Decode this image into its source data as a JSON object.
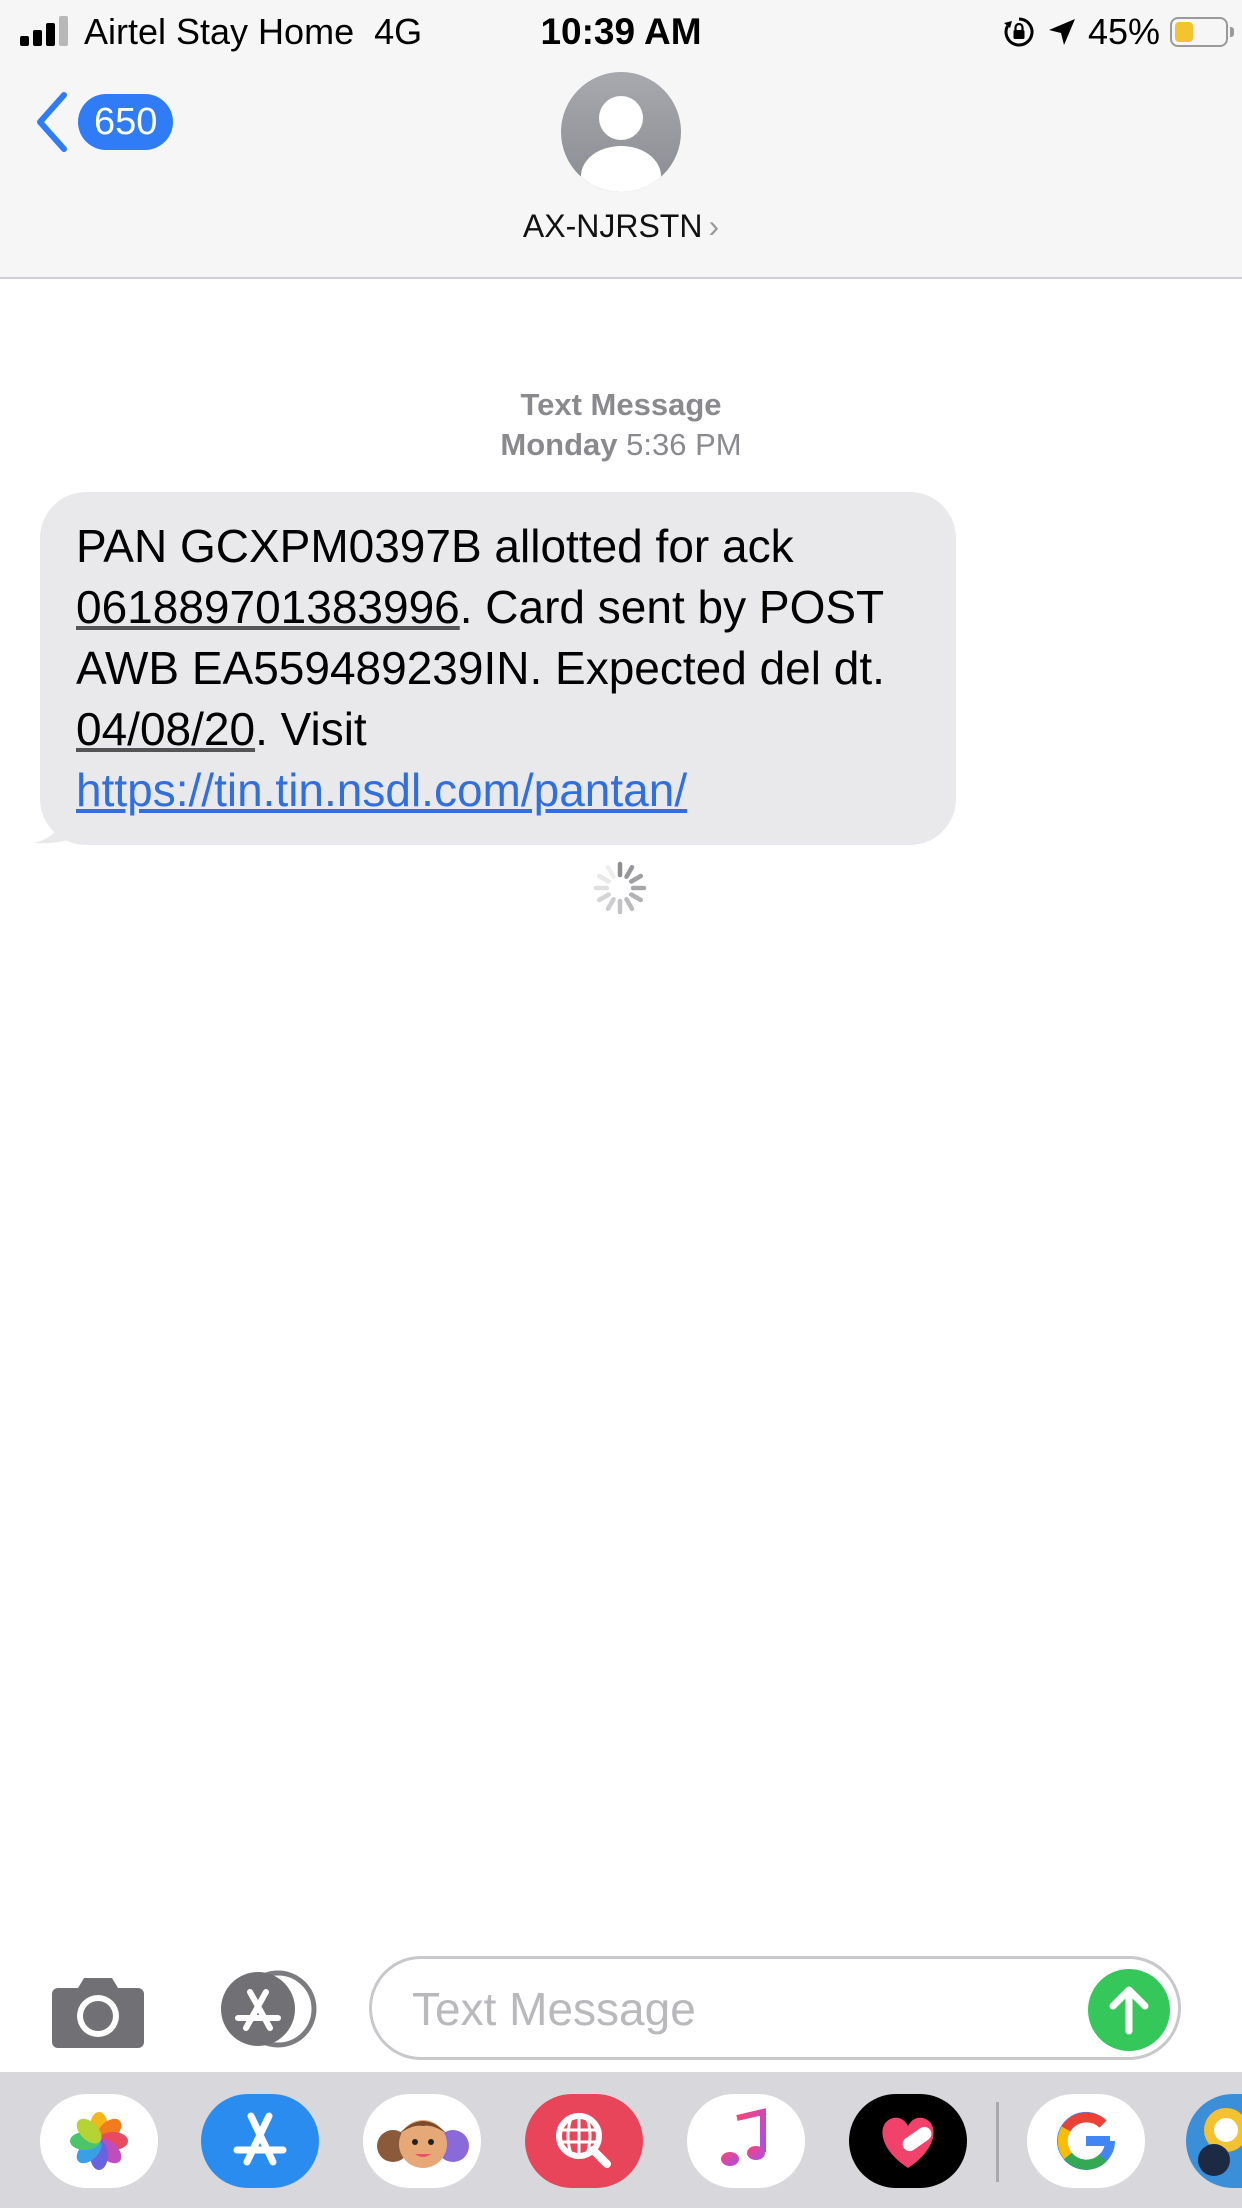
{
  "status_bar": {
    "carrier": "Airtel Stay Home",
    "network": "4G",
    "time": "10:39 AM",
    "battery_percent": "45%",
    "battery_level": 0.45,
    "icons": [
      "signal-icon",
      "orientation-lock-icon",
      "location-arrow-icon",
      "battery-icon"
    ]
  },
  "header": {
    "back_count": "650",
    "contact_name": "AX-NJRSTN",
    "chevron": "›"
  },
  "thread": {
    "service_label": "Text Message",
    "day": "Monday",
    "time": "5:36 PM",
    "message": {
      "part1": "PAN GCXPM0397B allotted for ack ",
      "ack_number": "061889701383996",
      "part2": ". Card sent by POST AWB EA559489239IN. Expected del dt. ",
      "date": "04/08/20",
      "part3": ". Visit ",
      "link": "https://tin.tin.nsdl.com/pantan/"
    }
  },
  "composer": {
    "placeholder": "Text Message"
  },
  "app_drawer": {
    "apps": [
      "Photos",
      "App Store",
      "Memoji",
      "Search",
      "Music",
      "Health",
      "Google",
      "Game"
    ]
  },
  "colors": {
    "accent": "#2f7cf6",
    "bubble": "#e9e9eb",
    "send": "#35c759",
    "link": "#2f6fe0"
  }
}
